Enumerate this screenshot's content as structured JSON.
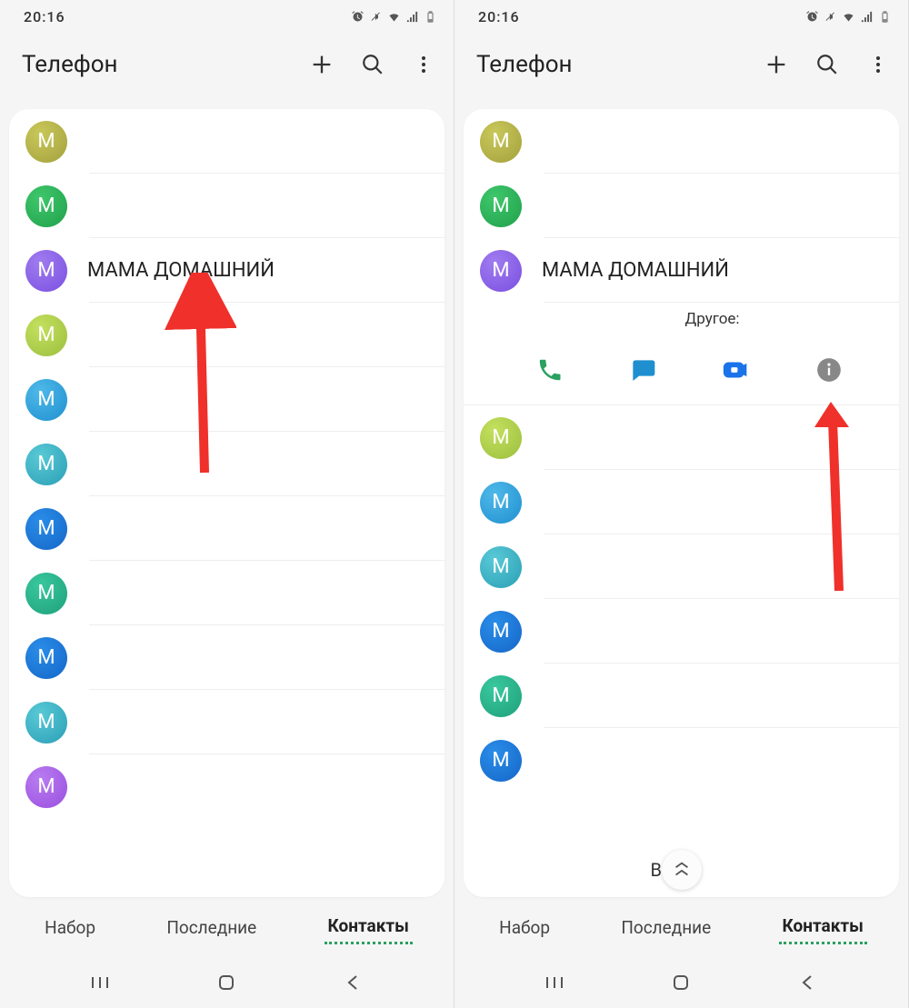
{
  "status": {
    "time": "20:16"
  },
  "header": {
    "title": "Телефон"
  },
  "contact_highlight": {
    "name": "МАМА ДОМАШНИЙ"
  },
  "expanded": {
    "label": "Другое:"
  },
  "tabs": {
    "dial": "Набор",
    "recent": "Последние",
    "contacts": "Контакты"
  },
  "avatar_letter": "M",
  "left_avatars": [
    {
      "bg": "radial-gradient(circle at 35% 30%, #c9c85a, #a3a03d)"
    },
    {
      "bg": "radial-gradient(circle at 35% 30%, #3fc76b, #1fa04b)"
    },
    {
      "bg": "radial-gradient(circle at 35% 30%, #a07cf0, #7a4fe0)"
    },
    {
      "bg": "radial-gradient(circle at 35% 30%, #c4e05e, #9bbf3e)"
    },
    {
      "bg": "radial-gradient(circle at 35% 30%, #4fb9e8, #1f8fd0)"
    },
    {
      "bg": "radial-gradient(circle at 35% 30%, #59c9d6, #2a9fb5)"
    },
    {
      "bg": "radial-gradient(circle at 35% 30%, #2a8de8, #1566c8)"
    },
    {
      "bg": "radial-gradient(circle at 35% 30%, #39c89e, #1fa07b)"
    },
    {
      "bg": "radial-gradient(circle at 35% 30%, #2a8de8, #1566c8)"
    },
    {
      "bg": "radial-gradient(circle at 35% 30%, #59c9d6, #2a9fb5)"
    },
    {
      "bg": "radial-gradient(circle at 35% 30%, #b87cf0, #9a4fe0)"
    }
  ],
  "right_avatars": [
    {
      "bg": "radial-gradient(circle at 35% 30%, #c9c85a, #a3a03d)"
    },
    {
      "bg": "radial-gradient(circle at 35% 30%, #3fc76b, #1fa04b)"
    },
    {
      "bg": "radial-gradient(circle at 35% 30%, #a07cf0, #7a4fe0)"
    },
    {
      "bg": "radial-gradient(circle at 35% 30%, #c4e05e, #9bbf3e)"
    },
    {
      "bg": "radial-gradient(circle at 35% 30%, #4fb9e8, #1f8fd0)"
    },
    {
      "bg": "radial-gradient(circle at 35% 30%, #59c9d6, #2a9fb5)"
    },
    {
      "bg": "radial-gradient(circle at 35% 30%, #2a8de8, #1566c8)"
    },
    {
      "bg": "radial-gradient(circle at 35% 30%, #39c89e, #1fa07b)"
    },
    {
      "bg": "radial-gradient(circle at 35% 30%, #2a8de8, #1566c8)"
    }
  ],
  "scroll_partial_letter": "В"
}
